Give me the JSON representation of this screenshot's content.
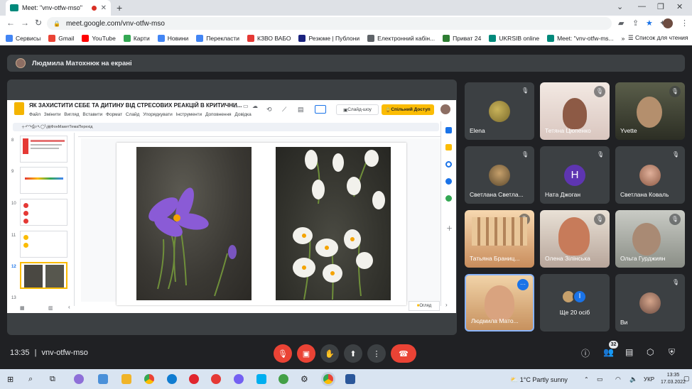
{
  "browser": {
    "tab_title": "Meet: \"vnv-otfw-mso\"",
    "new_tab": "+",
    "url": "meet.google.com/vnv-otfw-mso",
    "bookmarks": [
      {
        "label": "Сервисы",
        "color": "#4285f4"
      },
      {
        "label": "Gmail",
        "color": "#ea4335"
      },
      {
        "label": "YouTube",
        "color": "#ff0000"
      },
      {
        "label": "Карти",
        "color": "#34a853"
      },
      {
        "label": "Новини",
        "color": "#4285f4"
      },
      {
        "label": "Перекласти",
        "color": "#4285f4"
      },
      {
        "label": "КЗВО ВАБО",
        "color": "#e53935"
      },
      {
        "label": "Резюме | Публони",
        "color": "#1a237e"
      },
      {
        "label": "Електронний кабін...",
        "color": "#5f6368"
      },
      {
        "label": "Приват 24",
        "color": "#2e7d32"
      },
      {
        "label": "UKRSIB online",
        "color": "#00897b"
      },
      {
        "label": "Meet: \"vnv-otfw-ms...",
        "color": "#00897b"
      }
    ],
    "more_bookmarks": "»",
    "reading_list": "Список для чтения"
  },
  "meet": {
    "presenter_banner": "Людмила Матохнюк на екрані",
    "time": "13:35",
    "separator": "|",
    "meeting_code": "vnv-otfw-mso",
    "participants_count": "32",
    "colors": {
      "end_call": "#ea4335",
      "muted": "#ea4335",
      "active_speaker": "#8ab4f8"
    }
  },
  "slides": {
    "title": "ЯК ЗАХИСТИТИ СЕБЕ ТА ДИТИНУ ВІД СТРЕСОВИХ РЕАКЦІЙ В КРИТИЧНИ...",
    "menu": [
      "Файл",
      "Змінити",
      "Вигляд",
      "Вставити",
      "Формат",
      "Слайд",
      "Упорядкувати",
      "Інструменти",
      "Доповнення",
      "Довідка"
    ],
    "slideshow_label": "Слайд-шоу",
    "share_label": "Спільний Доступ",
    "toolbar": [
      "Фон",
      "Макет",
      "Тема",
      "Перехід"
    ],
    "slide_numbers": [
      "8",
      "9",
      "10",
      "11",
      "12",
      "13"
    ],
    "review_label": "Огляд"
  },
  "tiles": [
    {
      "name": "Elena"
    },
    {
      "name": "Тетяна Цюпенко"
    },
    {
      "name": "Yvette"
    },
    {
      "name": "Светлана Светла..."
    },
    {
      "name": "Ната Джоган",
      "initial": "H"
    },
    {
      "name": "Светлана Коваль"
    },
    {
      "name": "Татьяна Браниц..."
    },
    {
      "name": "Олена Зілінська"
    },
    {
      "name": "Ольга Гурджиян"
    },
    {
      "name": "Людмила Мато..."
    },
    {
      "name": "Ще 20 осіб",
      "initial": "I"
    },
    {
      "name": "Ви"
    }
  ],
  "taskbar": {
    "weather": "1°C  Partly sunny",
    "lang": "УКР",
    "clock_time": "13:35",
    "clock_date": "17.03.2022"
  }
}
